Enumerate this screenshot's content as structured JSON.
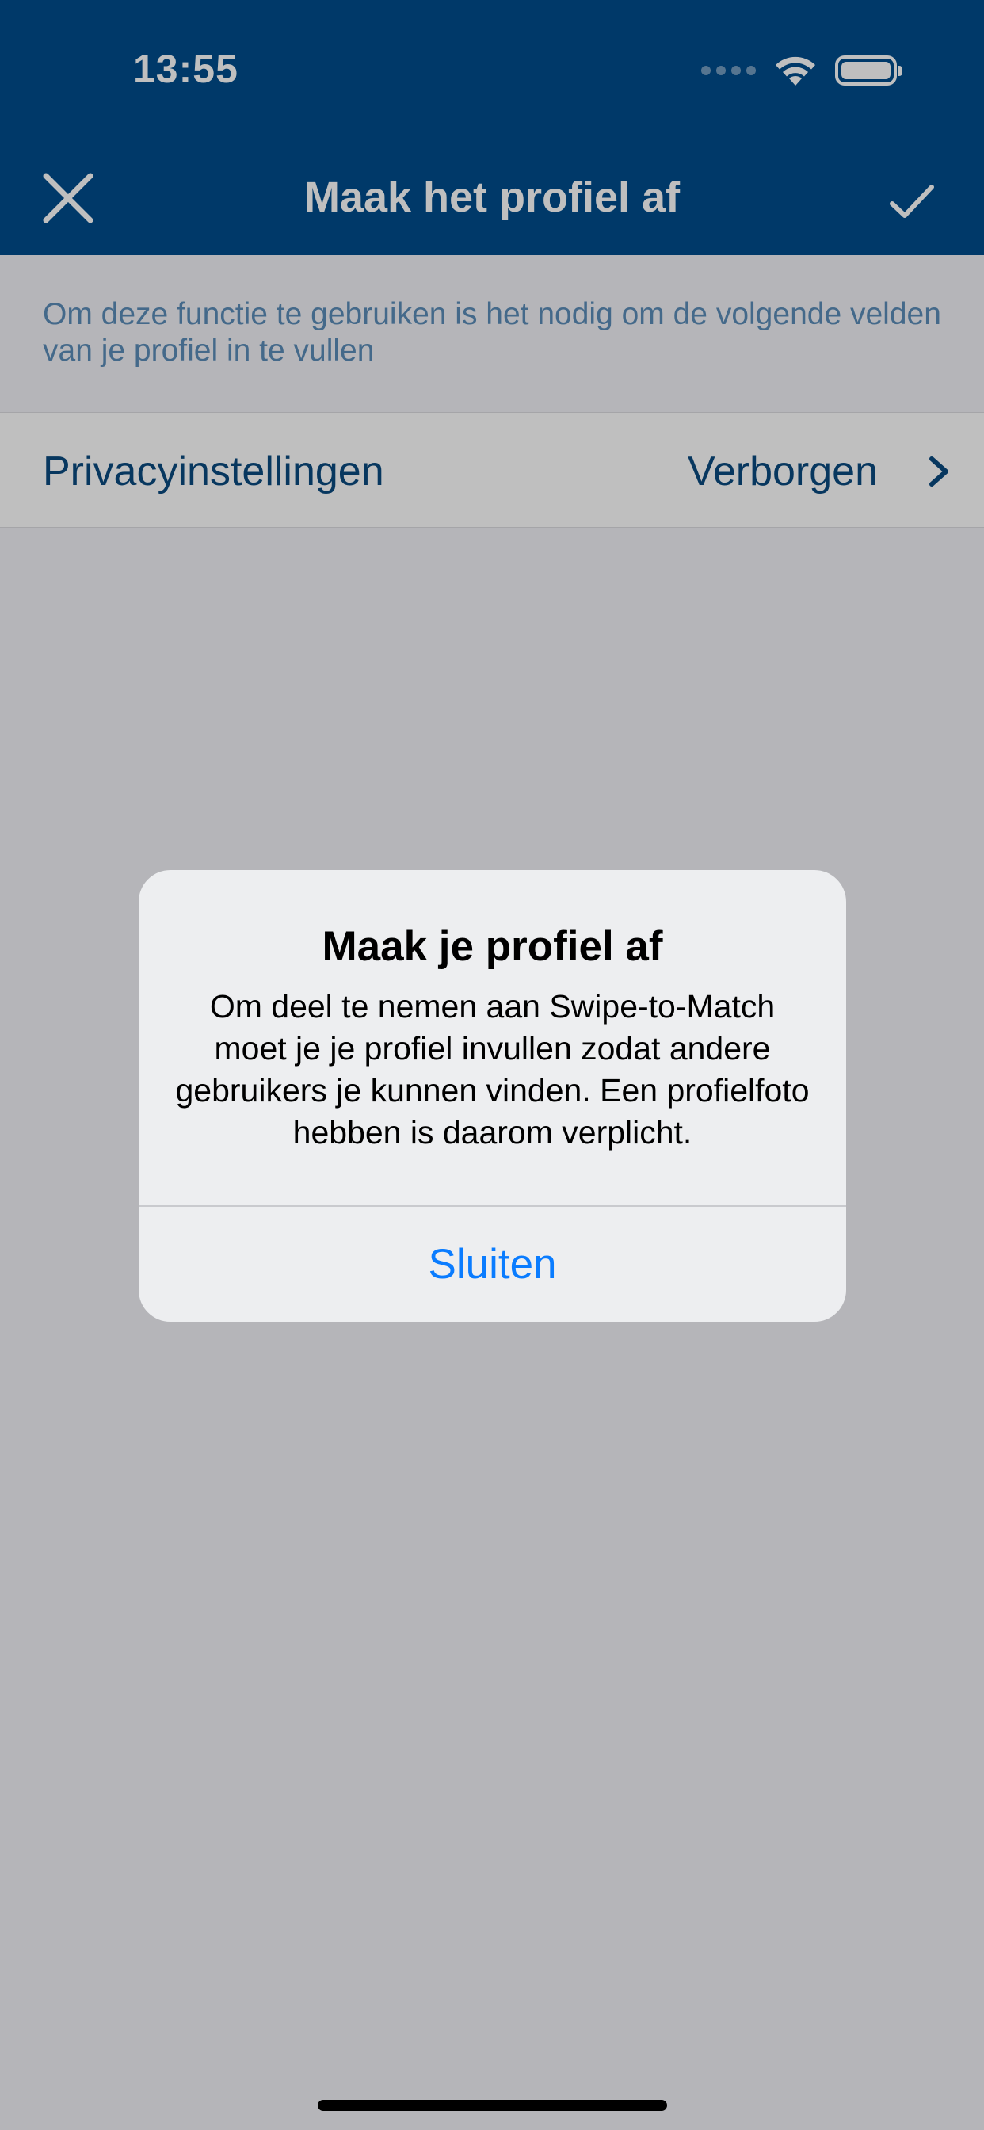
{
  "status_bar": {
    "time": "13:55"
  },
  "nav_bar": {
    "title": "Maak het profiel af",
    "close_icon": "close-icon",
    "confirm_icon": "checkmark-icon"
  },
  "content": {
    "description": "Om deze functie te gebruiken is het nodig om de volgende velden van je profiel in te vullen",
    "privacy_row": {
      "label": "Privacyinstellingen",
      "value": "Verborgen"
    }
  },
  "alert": {
    "title": "Maak je profiel af",
    "message": "Om deel te nemen aan Swipe-to-Match moet je je profiel invullen zodat andere gebruikers je kunnen vinden. Een profielfoto hebben is daarom verplicht.",
    "button_label": "Sluiten"
  },
  "colors": {
    "nav_blue": "#004c8c",
    "accent_blue": "#0a7cff"
  }
}
